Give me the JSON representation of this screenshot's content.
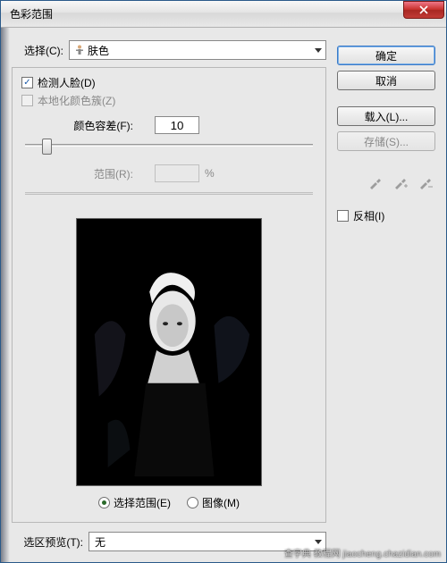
{
  "window": {
    "title": "色彩范围"
  },
  "select": {
    "label": "选择(C):",
    "value": "肤色"
  },
  "detect_faces": {
    "checked": true,
    "label": "检测人脸(D)"
  },
  "localized": {
    "checked": false,
    "label": "本地化颜色簇(Z)"
  },
  "fuzziness": {
    "label": "颜色容差(F):",
    "value": "10",
    "thumb_pct": 6
  },
  "range": {
    "label": "范围(R):",
    "value": "",
    "unit": "%"
  },
  "preview_mode": {
    "selection": {
      "label": "选择范围(E)",
      "on": true
    },
    "image": {
      "label": "图像(M)",
      "on": false
    }
  },
  "selection_preview": {
    "label": "选区预览(T):",
    "value": "无"
  },
  "buttons": {
    "ok": "确定",
    "cancel": "取消",
    "load": "载入(L)...",
    "save": "存储(S)..."
  },
  "invert": {
    "checked": false,
    "label": "反相(I)"
  },
  "watermark": "查字典  教程网  jiaocheng.chazidian.com"
}
